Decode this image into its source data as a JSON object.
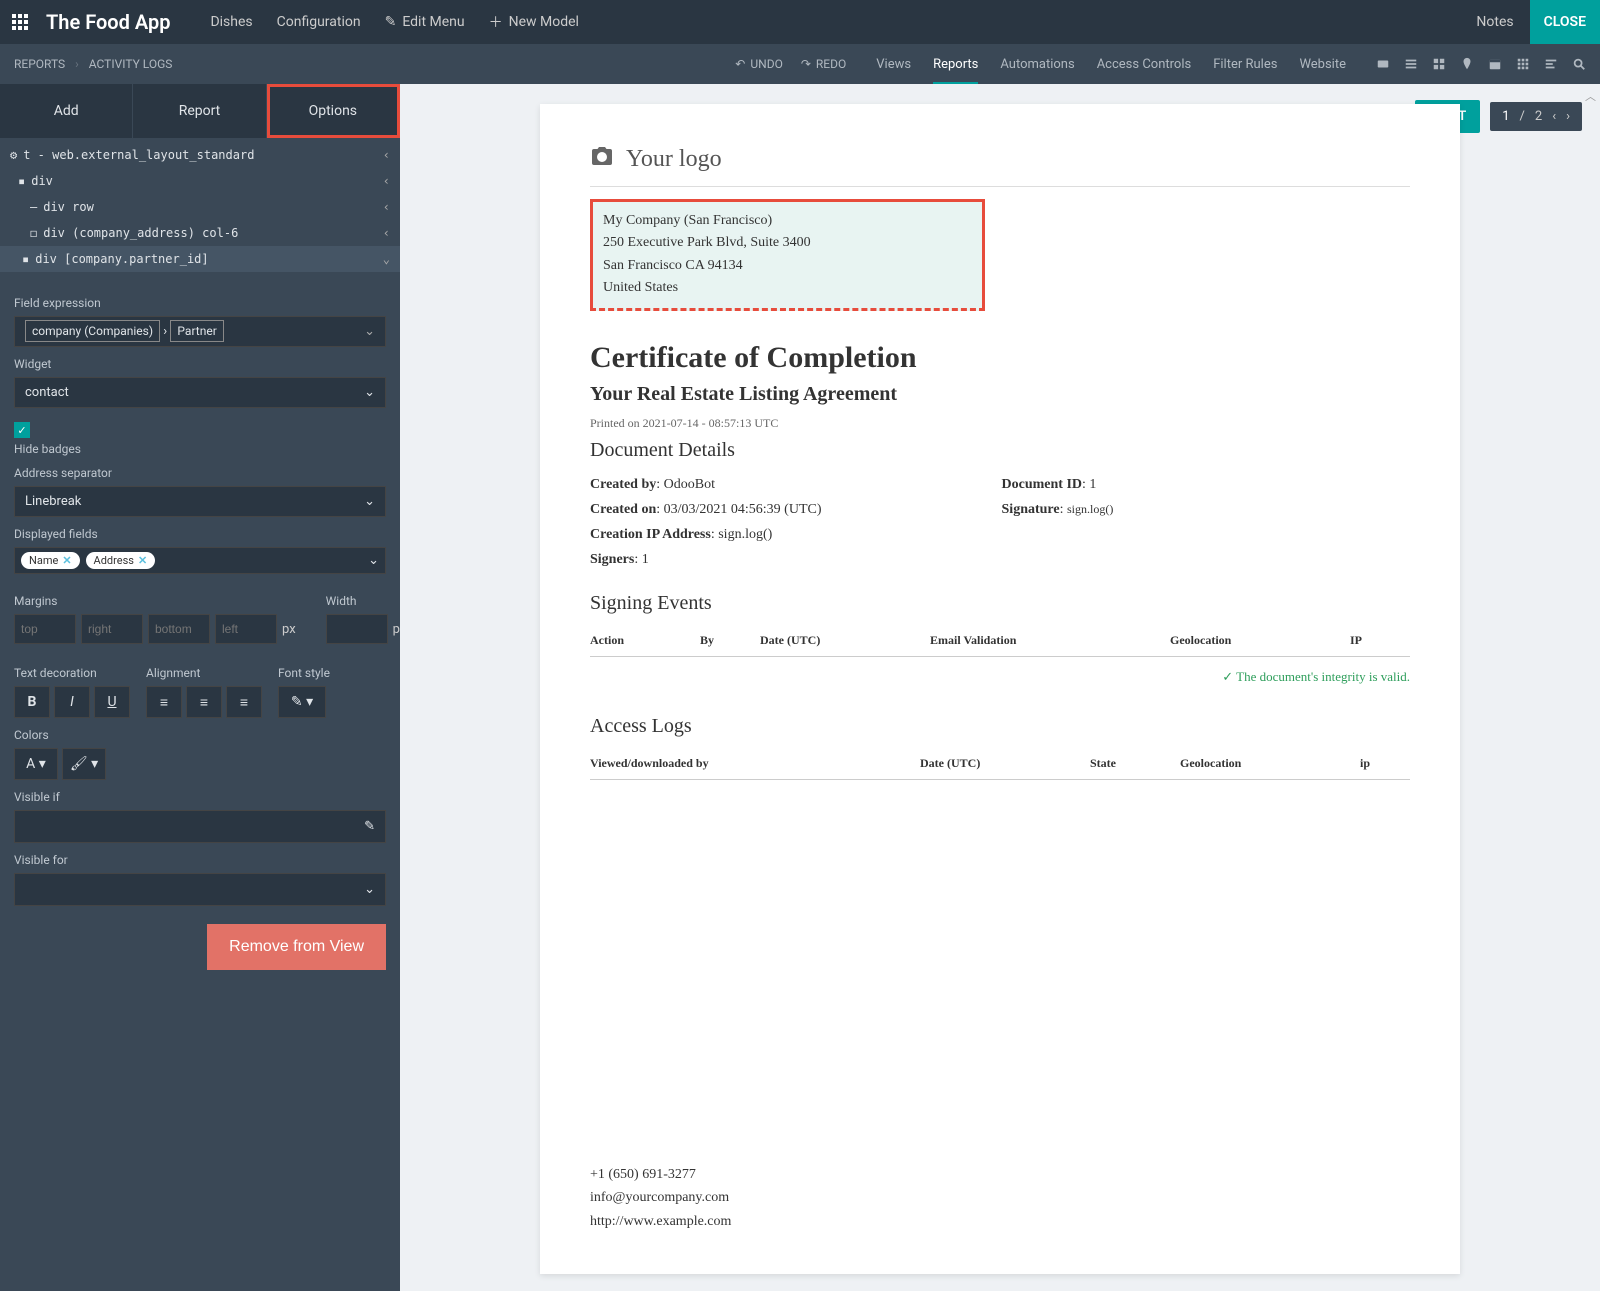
{
  "header": {
    "app_title": "The Food App",
    "nav": {
      "dishes": "Dishes",
      "config": "Configuration",
      "edit_menu": "Edit Menu",
      "new_model": "New Model"
    },
    "notes": "Notes",
    "close": "CLOSE"
  },
  "breadcrumb": {
    "reports": "REPORTS",
    "activity": "ACTIVITY LOGS"
  },
  "undo_redo": {
    "undo": "UNDO",
    "redo": "REDO"
  },
  "main_tabs": {
    "views": "Views",
    "reports": "Reports",
    "automations": "Automations",
    "access": "Access Controls",
    "filter": "Filter Rules",
    "website": "Website"
  },
  "sidebar_tabs": {
    "add": "Add",
    "report": "Report",
    "options": "Options"
  },
  "tree": {
    "r0": "t - web.external_layout_standard",
    "r1": "div",
    "r2": "div row",
    "r3": "div (company_address) col-6",
    "r4": "div [company.partner_id]"
  },
  "options": {
    "field_expr_label": "Field expression",
    "field_expr_company": "company (Companies)",
    "field_expr_partner": "Partner",
    "widget_label": "Widget",
    "widget_value": "contact",
    "hide_badges": "Hide badges",
    "addr_sep_label": "Address separator",
    "addr_sep_value": "Linebreak",
    "displayed_fields": "Displayed fields",
    "tag_name": "Name",
    "tag_address": "Address",
    "margins_label": "Margins",
    "width_label": "Width",
    "ph_top": "top",
    "ph_right": "right",
    "ph_bottom": "bottom",
    "ph_left": "left",
    "unit": "px",
    "text_dec": "Text decoration",
    "alignment": "Alignment",
    "font_style": "Font style",
    "colors": "Colors",
    "visible_if": "Visible if",
    "visible_for": "Visible for",
    "remove": "Remove from View"
  },
  "content_toolbar": {
    "print": "PRINT",
    "page_cur": "1",
    "page_sep": "/",
    "page_total": "2"
  },
  "doc": {
    "logo": "Your logo",
    "company_l1": "My Company (San Francisco)",
    "company_l2": "250 Executive Park Blvd, Suite 3400",
    "company_l3": "San Francisco CA 94134",
    "company_l4": "United States",
    "h1": "Certificate of Completion",
    "h2": "Your Real Estate Listing Agreement",
    "printed": "Printed on 2021-07-14 - 08:57:13 UTC",
    "doc_details": "Document Details",
    "created_by_l": "Created by",
    "created_by_v": ": OdooBot",
    "created_on_l": "Created on",
    "created_on_v": ": 03/03/2021 04:56:39 (UTC)",
    "ip_l": "Creation IP Address",
    "ip_v": ": sign.log()",
    "signers_l": "Signers",
    "signers_v": ": 1",
    "docid_l": "Document ID",
    "docid_v": ": 1",
    "sig_l": "Signature",
    "sig_v": ": ",
    "sig_fn": "sign.log()",
    "signing_events": "Signing Events",
    "th_action": "Action",
    "th_by": "By",
    "th_date": "Date (UTC)",
    "th_email": "Email Validation",
    "th_geo": "Geolocation",
    "th_ip": "IP",
    "integrity": "The document's integrity is valid.",
    "access_logs": "Access Logs",
    "th2_viewed": "Viewed/downloaded by",
    "th2_date": "Date (UTC)",
    "th2_state": "State",
    "th2_geo": "Geolocation",
    "th2_ip": "ip",
    "foot_phone": "+1 (650) 691-3277",
    "foot_email": "info@yourcompany.com",
    "foot_url": "http://www.example.com"
  }
}
